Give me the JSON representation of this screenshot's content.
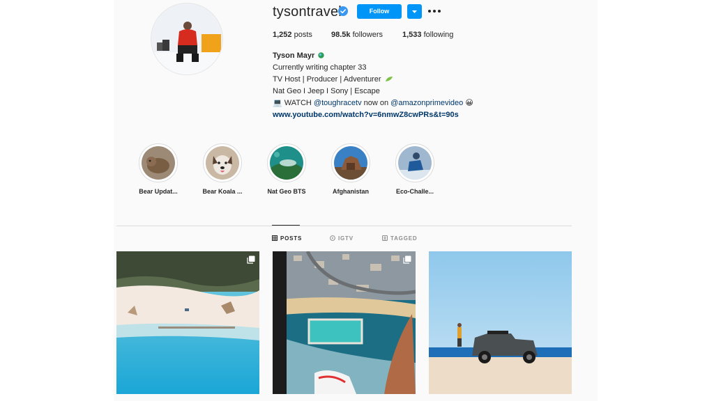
{
  "profile": {
    "username": "tysontravel",
    "follow_label": "Follow",
    "stats": {
      "posts_value": "1,252",
      "posts_label": "posts",
      "followers_value": "98.5k",
      "followers_label": "followers",
      "following_value": "1,533",
      "following_label": "following"
    },
    "bio": {
      "name": "Tyson Mayr",
      "line1": "Currently writing chapter 33 ⠀⠀",
      "line2": "TV Host | Producer | Adventurer",
      "line3": "Nat Geo I Jeep I Sony | Escape",
      "line4_prefix": "💻 WATCH ",
      "line4_mention1": "@toughracetv",
      "line4_middle": " now on ",
      "line4_mention2": "@amazonprimevideo",
      "line4_suffix": " 😀",
      "url": "www.youtube.com/watch?v=6nmwZ8cwPRs&t=90s"
    }
  },
  "highlights": [
    {
      "label": "Bear Updat..."
    },
    {
      "label": "Bear Koala ..."
    },
    {
      "label": "Nat Geo BTS"
    },
    {
      "label": "Afghanistan"
    },
    {
      "label": "Eco-Challe..."
    }
  ],
  "tabs": {
    "posts": "POSTS",
    "igtv": "IGTV",
    "tagged": "TAGGED"
  },
  "icons": {
    "verified": "verified-badge-icon",
    "dropdown": "chevron-down-icon",
    "more": "more-options-icon",
    "posts_tab": "grid-icon",
    "igtv_tab": "igtv-icon",
    "tagged_tab": "tag-icon",
    "multi_post": "carousel-icon"
  },
  "colors": {
    "accent": "#0095f6",
    "link": "#00376b",
    "text": "#262626",
    "muted": "#8e8e8e"
  }
}
